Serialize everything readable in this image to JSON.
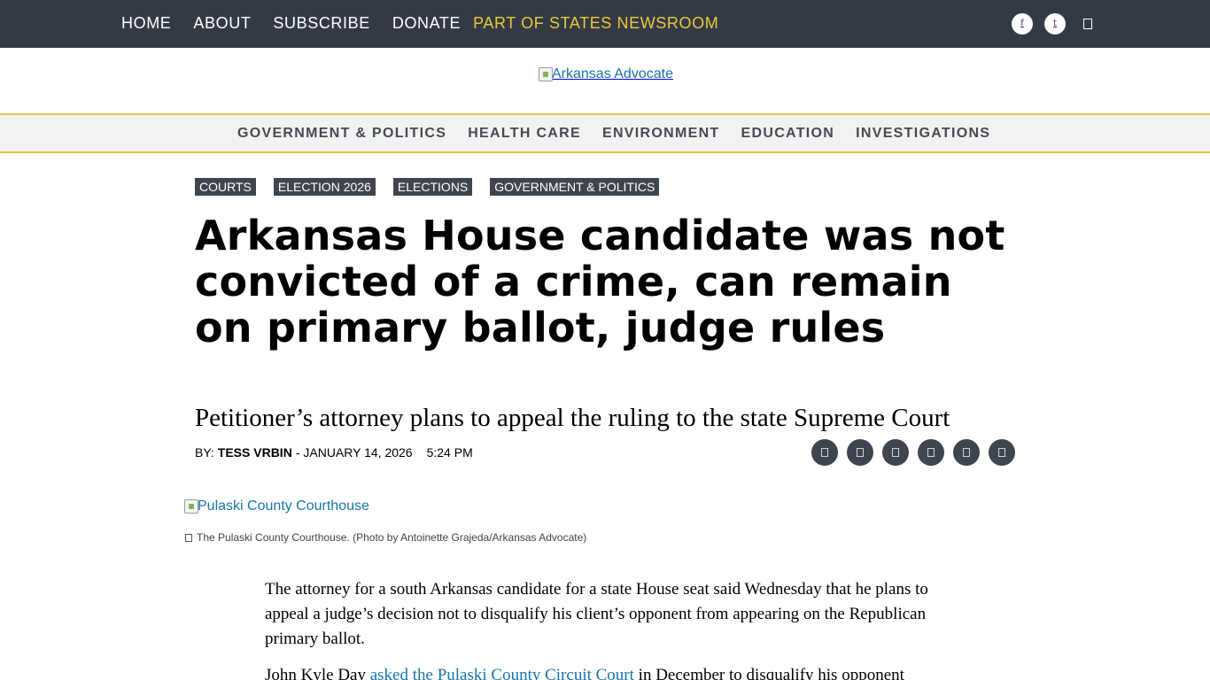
{
  "top_nav": {
    "home": "HOME",
    "about": "ABOUT",
    "subscribe": "SUBSCRIBE",
    "donate": "DONATE",
    "states_newsroom": "PART OF STATES NEWSROOM"
  },
  "top_icons": [
    "facebook-icon",
    "twitter-icon",
    "rss-icon"
  ],
  "logo": {
    "alt": "Arkansas Advocate"
  },
  "section_nav": {
    "government_politics": "GOVERNMENT & POLITICS",
    "health_care": "HEALTH CARE",
    "environment": "ENVIRONMENT",
    "education": "EDUCATION",
    "investigations": "INVESTIGATIONS"
  },
  "tags": {
    "courts": "COURTS",
    "election_2026": "ELECTION 2026",
    "elections": "ELECTIONS",
    "government_politics": "GOVERNMENT & POLITICS"
  },
  "article": {
    "headline": "Arkansas House candidate was not convicted of a crime, can remain on primary ballot, judge rules",
    "subhead": "Petitioner’s attorney plans to appeal the ruling to the state Supreme Court",
    "byline_prefix": "BY:",
    "author": "TESS VRBIN",
    "date": "- JANUARY 14, 2026",
    "time": "5:24 PM"
  },
  "share_icons": [
    "facebook-icon",
    "twitter-icon",
    "email-icon",
    "print-icon",
    "copy-link-icon",
    "republish-icon"
  ],
  "featured_image": {
    "alt": "Pulaski County Courthouse",
    "caption": "The Pulaski County Courthouse. (Photo by Antoinette Grajeda/Arkansas Advocate)"
  },
  "body": {
    "p1": "The attorney for a south Arkansas candidate for a state House seat said Wednesday that he plans to appeal a judge’s decision not to disqualify his client’s opponent from appearing on the Republican primary ballot.",
    "p2_before": "John Kyle Day ",
    "p2_link": "asked the Pulaski County Circuit Court",
    "p2_after": " in December to disqualify his opponent"
  },
  "colors": {
    "topbar_bg": "#333a45",
    "accent_gold": "#e1c24b",
    "states_text": "#e9c93c",
    "link_blue": "#1a74a8",
    "tag_bg": "#3f454f"
  }
}
